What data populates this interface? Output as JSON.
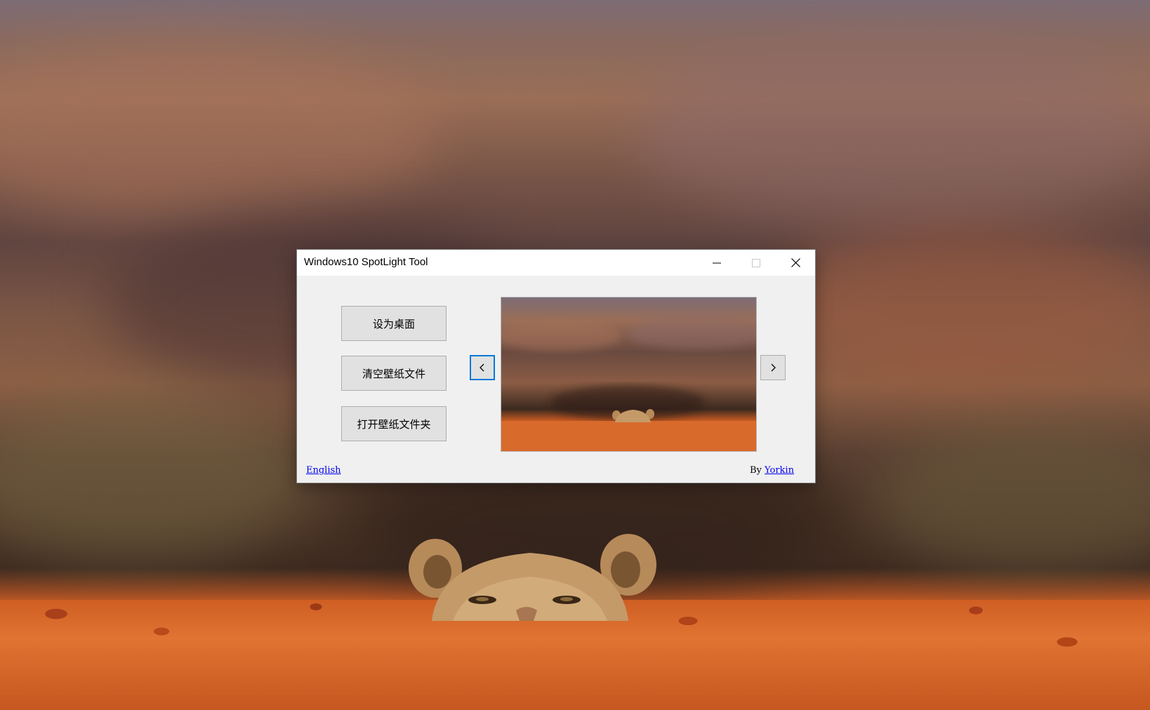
{
  "window": {
    "title": "Windows10 SpotLight Tool",
    "controls": {
      "minimize_icon": "minimize-icon",
      "maximize_icon": "maximize-icon",
      "close_icon": "close-icon"
    }
  },
  "actions": {
    "set_desktop": "设为桌面",
    "clear_wallpaper_files": "清空壁纸文件",
    "open_wallpaper_folder": "打开壁纸文件夹"
  },
  "navigation": {
    "prev_icon": "chevron-left-icon",
    "next_icon": "chevron-right-icon"
  },
  "footer": {
    "language_link": "English",
    "by_label": "By",
    "author_link": "Yorkin"
  },
  "colors": {
    "window_bg": "#f0f0f0",
    "titlebar_bg": "#ffffff",
    "button_bg": "#e1e1e1",
    "focus_border": "#0078d7",
    "link": "#0000ee"
  }
}
